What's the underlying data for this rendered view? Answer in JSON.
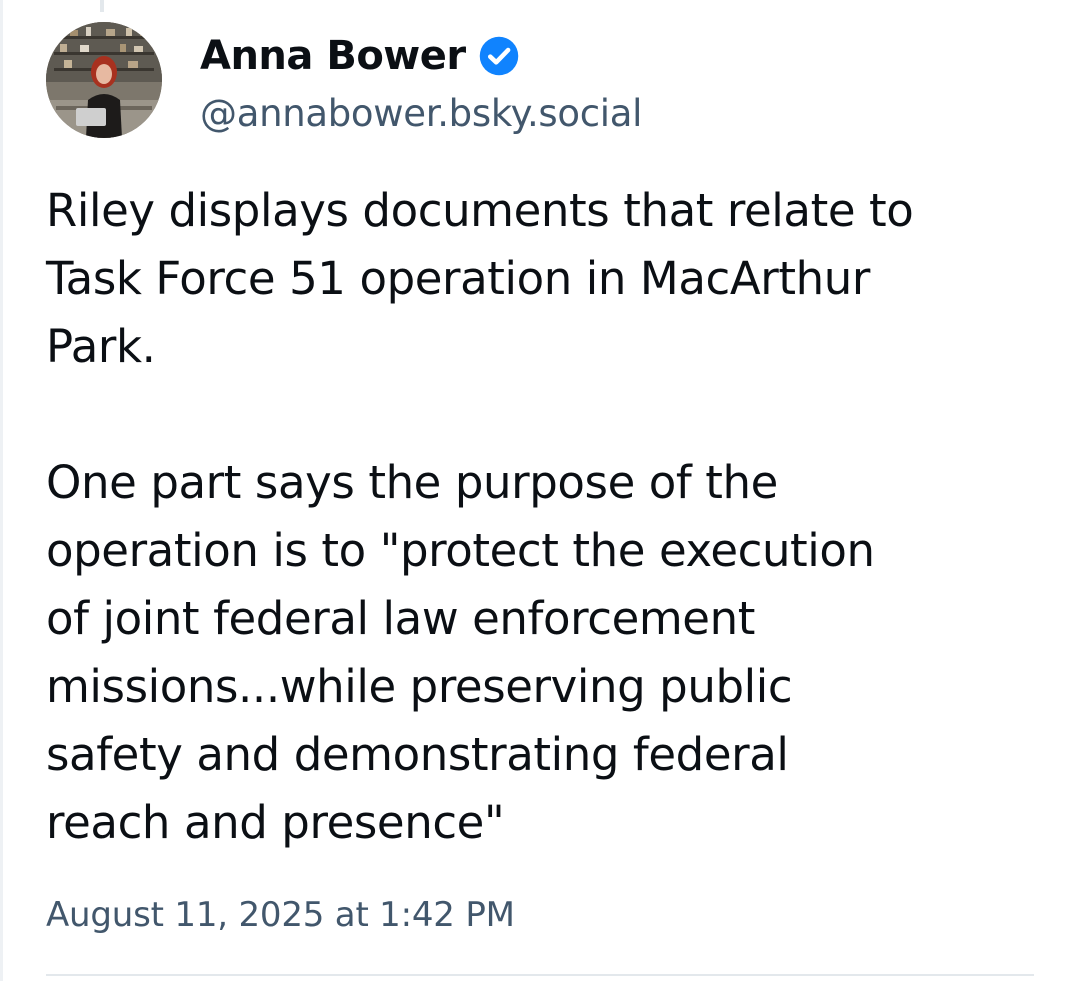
{
  "post": {
    "author": {
      "display_name": "Anna Bower",
      "handle": "@annabower.bsky.social",
      "verified": true,
      "avatar_icon": "avatar-photo",
      "verified_icon": "verified-check-icon"
    },
    "body": {
      "paragraph_1": [
        "Riley displays documents that relate to",
        "Task Force 51 operation in MacArthur",
        "Park."
      ],
      "paragraph_2": [
        "One part says the purpose of the",
        "operation is to \"protect the execution",
        "of joint federal law enforcement",
        "missions...while preserving public",
        "safety and demonstrating federal",
        "reach and presence\""
      ]
    },
    "timestamp": "August 11, 2025 at 1:42 PM"
  },
  "colors": {
    "text_primary": "#0b0f14",
    "text_secondary": "#42576c",
    "verified_blue": "#1083fe",
    "divider": "#e3e8ec"
  }
}
